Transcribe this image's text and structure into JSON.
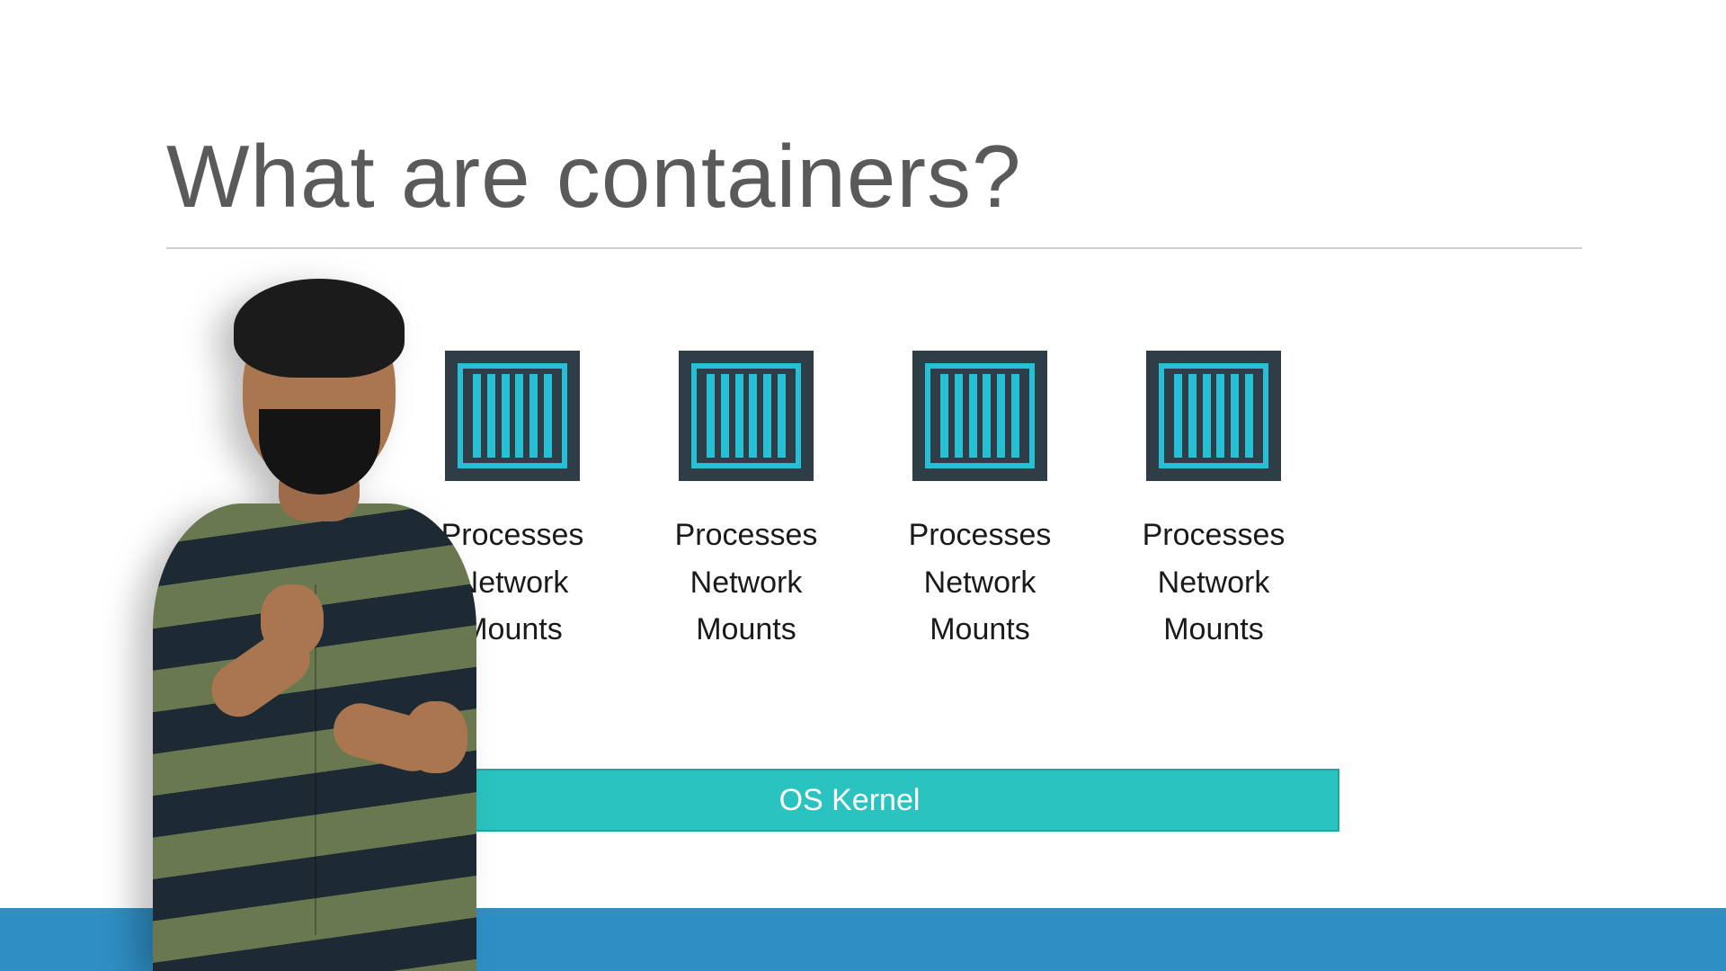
{
  "slide": {
    "title": "What are containers?"
  },
  "containers": [
    {
      "labels": [
        "Processes",
        "Network",
        "Mounts"
      ]
    },
    {
      "labels": [
        "Processes",
        "Network",
        "Mounts"
      ]
    },
    {
      "labels": [
        "Processes",
        "Network",
        "Mounts"
      ]
    },
    {
      "labels": [
        "Processes",
        "Network",
        "Mounts"
      ]
    }
  ],
  "kernel": {
    "label": "OS Kernel"
  },
  "colors": {
    "accent_teal": "#2bc3bf",
    "icon_cyan": "#26c0d6",
    "icon_bg": "#2f3e46",
    "band_blue": "#2f8fc4",
    "title_gray": "#5a5a5a"
  }
}
